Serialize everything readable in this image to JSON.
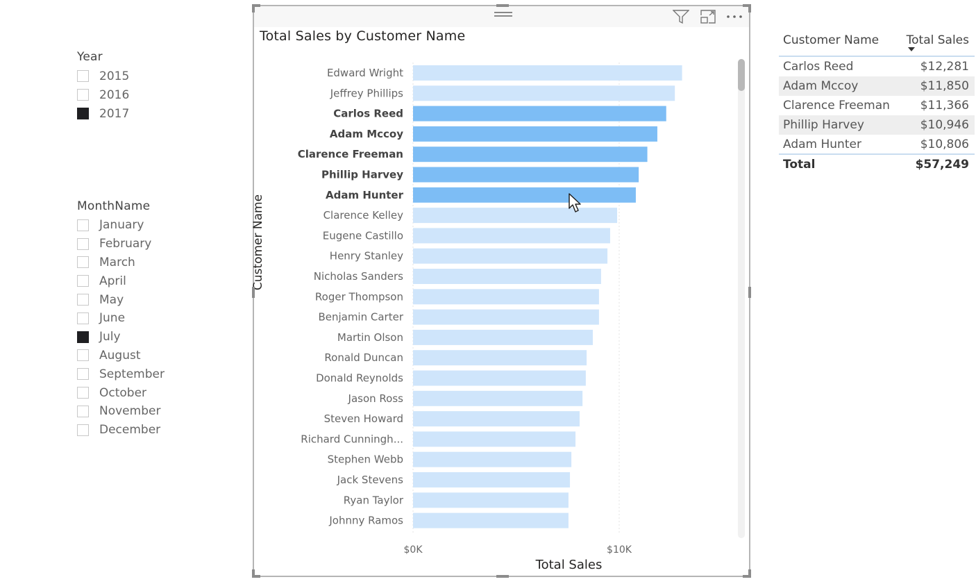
{
  "slicers": {
    "year": {
      "title": "Year",
      "items": [
        {
          "label": "2015",
          "checked": false
        },
        {
          "label": "2016",
          "checked": false
        },
        {
          "label": "2017",
          "checked": true
        }
      ]
    },
    "month": {
      "title": "MonthName",
      "items": [
        {
          "label": "January",
          "checked": false
        },
        {
          "label": "February",
          "checked": false
        },
        {
          "label": "March",
          "checked": false
        },
        {
          "label": "April",
          "checked": false
        },
        {
          "label": "May",
          "checked": false
        },
        {
          "label": "June",
          "checked": false
        },
        {
          "label": "July",
          "checked": true
        },
        {
          "label": "August",
          "checked": false
        },
        {
          "label": "September",
          "checked": false
        },
        {
          "label": "October",
          "checked": false
        },
        {
          "label": "November",
          "checked": false
        },
        {
          "label": "December",
          "checked": false
        }
      ]
    }
  },
  "visual_header": {
    "icons": [
      "filter-icon",
      "focus-mode-icon",
      "more-options-icon"
    ]
  },
  "colors": {
    "bar_highlighted": "#7dbdf5",
    "bar_default": "#cfe5fb",
    "checkbox_checked": "#1f1f22",
    "table_rule": "#c9ddf0"
  },
  "chart_data": {
    "type": "bar",
    "orientation": "horizontal",
    "title": "Total Sales by Customer Name",
    "xlabel": "Total Sales",
    "ylabel": "Customer Name",
    "xlim": [
      0,
      14000
    ],
    "xticks": [
      0,
      10000
    ],
    "xtick_labels": [
      "$0K",
      "$10K"
    ],
    "grid": true,
    "categories": [
      "Edward Wright",
      "Jeffrey Phillips",
      "Carlos Reed",
      "Adam Mccoy",
      "Clarence Freeman",
      "Phillip Harvey",
      "Adam Hunter",
      "Clarence Kelley",
      "Eugene Castillo",
      "Henry Stanley",
      "Nicholas Sanders",
      "Roger Thompson",
      "Benjamin Carter",
      "Martin Olson",
      "Ronald Duncan",
      "Donald Reynolds",
      "Jason Ross",
      "Steven Howard",
      "Richard Cunningh...",
      "Stephen Webb",
      "Jack Stevens",
      "Ryan Taylor",
      "Johnny Ramos"
    ],
    "values": [
      13050,
      12700,
      12281,
      11850,
      11366,
      10946,
      10806,
      9900,
      9560,
      9430,
      9120,
      9020,
      9020,
      8720,
      8420,
      8380,
      8220,
      8080,
      7880,
      7680,
      7610,
      7540,
      7540
    ],
    "highlighted": [
      false,
      false,
      true,
      true,
      true,
      true,
      true,
      false,
      false,
      false,
      false,
      false,
      false,
      false,
      false,
      false,
      false,
      false,
      false,
      false,
      false,
      false,
      false
    ]
  },
  "table": {
    "columns": [
      "Customer Name",
      "Total Sales"
    ],
    "sort_column": "Total Sales",
    "rows": [
      {
        "name": "Carlos Reed",
        "sales": "$12,281"
      },
      {
        "name": "Adam Mccoy",
        "sales": "$11,850"
      },
      {
        "name": "Clarence Freeman",
        "sales": "$11,366"
      },
      {
        "name": "Phillip Harvey",
        "sales": "$10,946"
      },
      {
        "name": "Adam Hunter",
        "sales": "$10,806"
      }
    ],
    "total_label": "Total",
    "total_value": "$57,249"
  }
}
